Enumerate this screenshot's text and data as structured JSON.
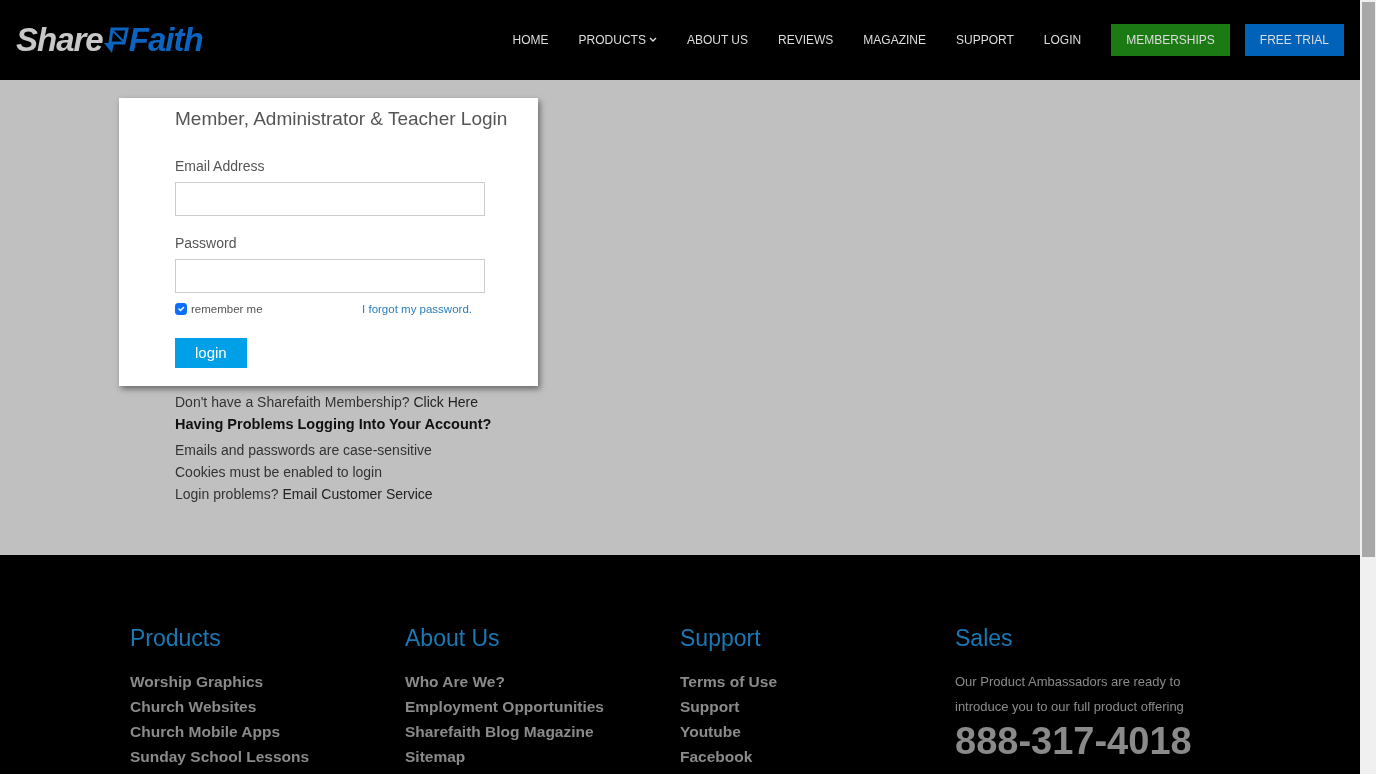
{
  "logo": {
    "part_1": "Share",
    "part_2": "Faith"
  },
  "nav": {
    "items": [
      {
        "label": "HOME",
        "dropdown": false
      },
      {
        "label": "PRODUCTS",
        "dropdown": true
      },
      {
        "label": "ABOUT US",
        "dropdown": false
      },
      {
        "label": "REVIEWS",
        "dropdown": false
      },
      {
        "label": "MAGAZINE",
        "dropdown": false
      },
      {
        "label": "SUPPORT",
        "dropdown": false
      },
      {
        "label": "LOGIN",
        "dropdown": false
      }
    ],
    "buttons": [
      {
        "label": "MEMBERSHIPS",
        "color": "#1c7a14"
      },
      {
        "label": "FREE TRIAL",
        "color": "#0062b8"
      }
    ]
  },
  "login": {
    "title": "Member, Administrator & Teacher Login",
    "email_label": "Email Address",
    "password_label": "Password",
    "remember": {
      "label": "remember me",
      "checked": true
    },
    "forgot_link": "I forgot my password.",
    "submit": "login"
  },
  "help": {
    "signup": {
      "text": "Don't have a Sharefaith Membership?",
      "link": "Click Here"
    },
    "heading": "Having Problems Logging Into Your Account?",
    "lines": [
      {
        "text": "Emails and passwords are case-sensitive"
      },
      {
        "text": "Cookies must be enabled to login"
      },
      {
        "text": "Login problems?",
        "link": "Email Customer Service"
      }
    ]
  },
  "footer": {
    "columns": [
      {
        "title": "Products",
        "kind": "links",
        "links": [
          "Worship Graphics",
          "Church Websites",
          "Church Mobile Apps",
          "Sunday School Lessons"
        ]
      },
      {
        "title": "About Us",
        "kind": "links",
        "links": [
          "Who Are We?",
          "Employment Opportunities",
          "Sharefaith Blog Magazine",
          "Sitemap"
        ]
      },
      {
        "title": "Support",
        "kind": "links",
        "links": [
          "Terms of Use",
          "Support",
          "Youtube",
          "Facebook"
        ]
      },
      {
        "title": "Sales",
        "kind": "contact",
        "text": "Our Product Ambassadors are ready to introduce you to our full product offering",
        "phone": "888-317-4018"
      }
    ]
  }
}
